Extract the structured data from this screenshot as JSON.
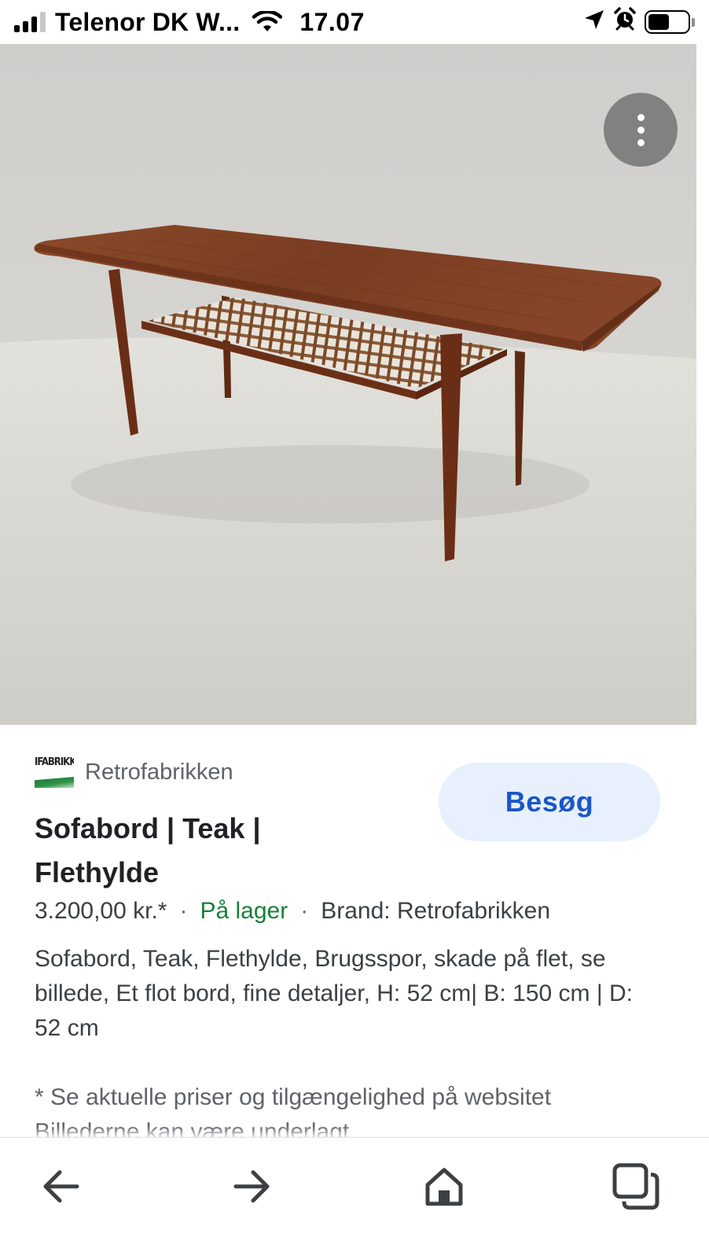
{
  "status_bar": {
    "carrier": "Telenor DK W...",
    "time": "17.07",
    "icons": [
      "cellular-signal-icon",
      "wifi-icon",
      "location-arrow-icon",
      "alarm-clock-icon",
      "battery-icon"
    ],
    "battery_level": 0.55
  },
  "image": {
    "more_button_icon": "more-vertical-icon"
  },
  "merchant": {
    "logo_text": "IFABRIKKI",
    "name": "Retrofabrikken"
  },
  "visit_button": {
    "label": "Besøg"
  },
  "product": {
    "title": "Sofabord | Teak | Flethylde",
    "price": "3.200,00 kr.*",
    "separator": "·",
    "stock": "På lager",
    "brand": "Brand: Retrofabrikken",
    "description": "Sofabord, Teak, Flethylde, Brugsspor, skade på flet, se billede, Et flot bord, fine detaljer, H: 52 cm| B: 150 cm | D: 52 cm",
    "disclaimer": "* Se aktuelle priser og tilgængelighed på websitet Billederne kan være underlagt"
  },
  "bottom_bar": {
    "icons": [
      "back-arrow-icon",
      "forward-arrow-icon",
      "home-icon",
      "tabs-icon"
    ]
  },
  "colors": {
    "visit_button_bg": "#e8f0fe",
    "visit_button_text": "#1a57c8",
    "stock_green": "#188038",
    "wood": "#7a3a1e"
  }
}
